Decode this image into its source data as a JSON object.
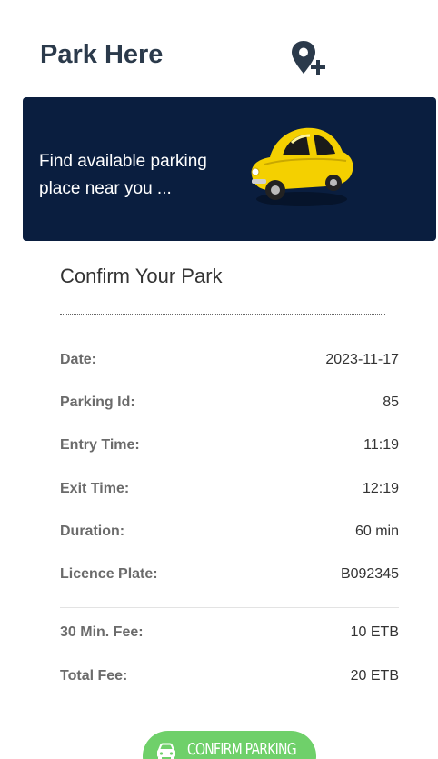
{
  "header": {
    "title": "Park Here",
    "add_location_icon": "map-pin-plus-icon"
  },
  "hero": {
    "text": "Find available parking place near you ...",
    "image": "yellow-toy-car",
    "background": "#0a1e3f"
  },
  "confirm": {
    "title": "Confirm Your Park",
    "details": [
      {
        "label": "Date:",
        "value": "2023-11-17"
      },
      {
        "label": "Parking Id:",
        "value": "85"
      },
      {
        "label": "Entry Time:",
        "value": "11:19"
      },
      {
        "label": "Exit Time:",
        "value": "12:19"
      },
      {
        "label": "Duration:",
        "value": "60 min"
      },
      {
        "label": "Licence Plate:",
        "value": "B092345"
      }
    ],
    "fees": [
      {
        "label": "30 Min. Fee:",
        "value": "10 ETB"
      },
      {
        "label": "Total Fee:",
        "value": "20 ETB"
      }
    ]
  },
  "action": {
    "button_label": "CONFIRM PARKING",
    "button_icon": "car-icon",
    "button_color": "#6fd06a"
  }
}
